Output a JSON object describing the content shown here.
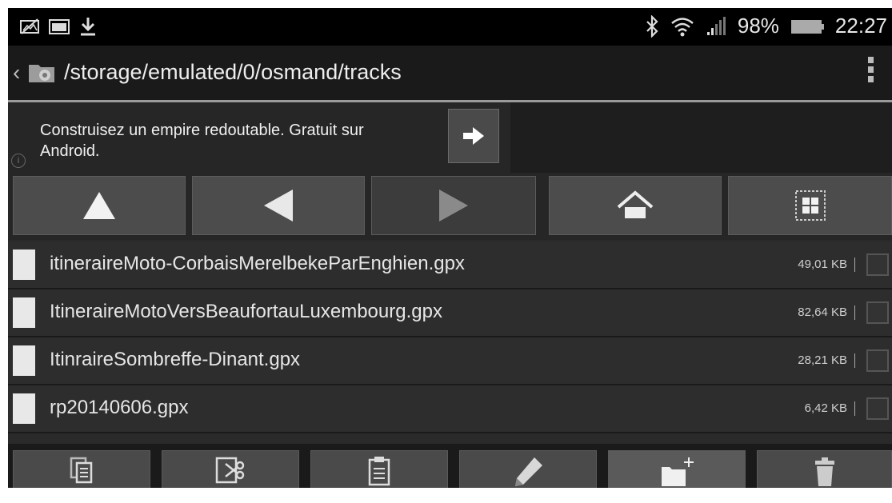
{
  "status_bar": {
    "battery": "98%",
    "time": "22:27",
    "icons": [
      "picture-disabled-icon",
      "image-icon",
      "download-icon",
      "bluetooth-icon",
      "wifi-icon",
      "signal-icon",
      "battery-icon"
    ]
  },
  "path_bar": {
    "path": "/storage/emulated/0/osmand/tracks",
    "icons": [
      "back-chevron-icon",
      "folder-app-icon",
      "overflow-menu-icon"
    ]
  },
  "ad": {
    "text": "Construisez un empire redoutable. Gratuit sur Android.",
    "info_glyph": "i",
    "icons": [
      "info-icon",
      "arrow-right-icon"
    ]
  },
  "nav_buttons": [
    {
      "name": "up-button",
      "icon": "triangle-up-icon"
    },
    {
      "name": "back-button",
      "icon": "triangle-left-icon"
    },
    {
      "name": "forward-button",
      "icon": "triangle-right-icon"
    },
    {
      "name": "home-button",
      "icon": "home-icon"
    },
    {
      "name": "grid-view-button",
      "icon": "grid-icon"
    }
  ],
  "files": [
    {
      "name": "itineraireMoto-CorbaisMerelbekeParEnghien.gpx",
      "size": "49,01 KB"
    },
    {
      "name": "ItineraireMotoVersBeaufortauLuxembourg.gpx",
      "size": "82,64 KB"
    },
    {
      "name": "ItinraireSombreffe-Dinant.gpx",
      "size": "28,21 KB"
    },
    {
      "name": "rp20140606.gpx",
      "size": "6,42 KB"
    }
  ],
  "toolbar": [
    {
      "name": "copy-button",
      "icon": "copy-icon"
    },
    {
      "name": "cut-button",
      "icon": "cut-icon"
    },
    {
      "name": "paste-button",
      "icon": "paste-icon"
    },
    {
      "name": "rename-button",
      "icon": "pencil-icon"
    },
    {
      "name": "new-folder-button",
      "icon": "new-folder-icon"
    },
    {
      "name": "delete-button",
      "icon": "trash-icon"
    }
  ],
  "colors": {
    "background": "#2a2a2a",
    "status_bar": "#000000",
    "button": "#4c4c4c",
    "text": "#e6e6e6"
  }
}
